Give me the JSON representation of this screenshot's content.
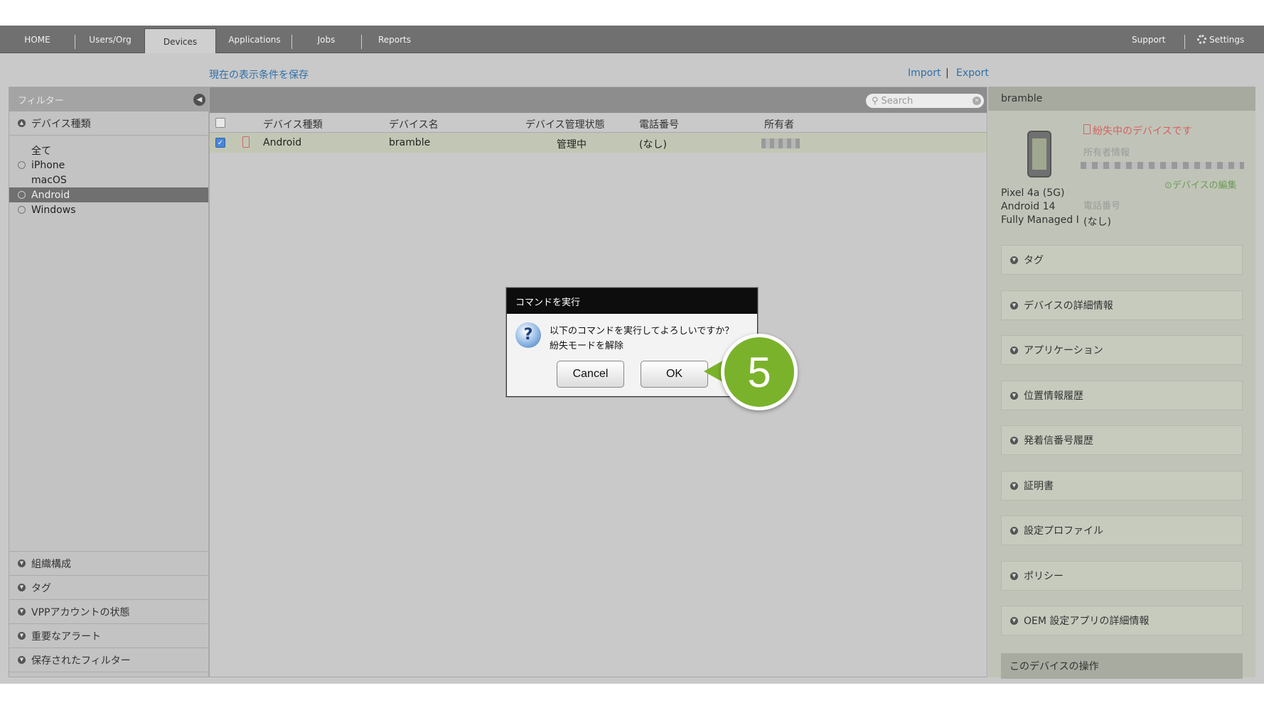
{
  "nav": {
    "tabs": [
      "HOME",
      "Users/Org",
      "Devices",
      "Applications",
      "Jobs",
      "Reports"
    ],
    "active_tab": "Devices",
    "support": "Support",
    "settings": "Settings"
  },
  "links": {
    "save_filter": "現在の表示条件を保存",
    "import": "Import",
    "separator": "|",
    "export": "Export"
  },
  "sidebar": {
    "header": "フィルター",
    "device_type_section": "デバイス種類",
    "filters": [
      "全て",
      "iPhone",
      "macOS",
      "Android",
      "Windows"
    ],
    "selected_filter": "Android",
    "bottom_sections": [
      "組織構成",
      "タグ",
      "VPPアカウントの状態",
      "重要なアラート",
      "保存されたフィルター"
    ]
  },
  "table": {
    "search_placeholder": "Search",
    "columns": [
      "デバイス種類",
      "デバイス名",
      "デバイス管理状態",
      "電話番号",
      "所有者"
    ],
    "rows": [
      {
        "type": "Android",
        "name": "bramble",
        "state": "管理中",
        "phone": "(なし)",
        "checked": true
      }
    ]
  },
  "detail": {
    "title": "bramble",
    "lost_alert": "紛失中のデバイスです",
    "owner_label": "所有者情報",
    "edit_link": "デバイスの編集",
    "model": "Pixel 4a (5G)",
    "os": "Android 14",
    "mode": "Fully Managed I",
    "phone_label": "電話番号",
    "phone_value": "(なし)",
    "sections": [
      "タグ",
      "デバイスの詳細情報",
      "アプリケーション",
      "位置情報履歴",
      "発着信番号履歴",
      "証明書",
      "設定プロファイル",
      "ポリシー",
      "OEM 設定アプリの詳細情報"
    ],
    "footer": "このデバイスの操作"
  },
  "dialog": {
    "title": "コマンドを実行",
    "message_line1": "以下のコマンドを実行してよろしいですか？",
    "message_line2": "紛失モードを解除",
    "cancel": "Cancel",
    "ok": "OK",
    "icon": "question-icon"
  },
  "callout": {
    "step": "5"
  },
  "colors": {
    "callout": "#7bb22b",
    "link": "#2f6fa8",
    "alert": "#d95f5f",
    "nav": "#707070"
  }
}
